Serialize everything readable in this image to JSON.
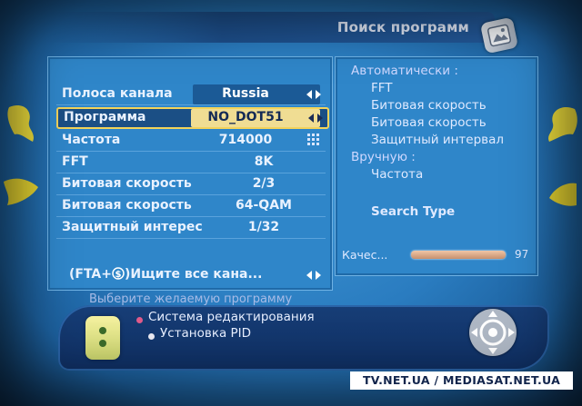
{
  "title": "Поиск программ",
  "rows": [
    {
      "label": "Полоса канала",
      "value": "Russia",
      "has_arrows": true
    },
    {
      "label": "Программа",
      "value": "NO_DOT51",
      "has_arrows": true,
      "selected": true
    },
    {
      "label": "Частота",
      "value": "714000",
      "has_keypad": true
    },
    {
      "label": "FFT",
      "value": "8K"
    },
    {
      "label": "Битовая скорость",
      "value": "2/3"
    },
    {
      "label": "Битовая скорость",
      "value": "64-QAM"
    },
    {
      "label": "Защитный интерес",
      "value": "1/32"
    }
  ],
  "search_all": {
    "prefix": "(FTA+",
    "suffix": ")Ищите все кана...",
    "has_arrows": true
  },
  "right_panel": {
    "auto_header": "Автоматически :",
    "auto_items": [
      "FFT",
      "Битовая скорость",
      "Битовая скорость",
      "Защитный интервал"
    ],
    "manual_header": "Вручную :",
    "manual_items": [
      "Частота"
    ],
    "search_type": "Search Type",
    "quality_label": "Качес...",
    "quality_value": "97",
    "quality_fraction": 0.97
  },
  "hint": "Выберите желаемую программу",
  "options": [
    {
      "label": "Система редактирования",
      "bullet_color": "#e05a8a"
    },
    {
      "label": "Установка PID",
      "bullet_color": "#e9e9f2"
    }
  ],
  "watermark": "TV.NET.UA / MEDIASAT.NET.UA",
  "icons": [
    "photo-icon",
    "left-right-arrows-icon",
    "keypad-icon",
    "dollar-coin-icon",
    "info-icon",
    "remote-dpad-icon"
  ],
  "colors": {
    "panel": "#2f86c9",
    "highlight_border": "#f3d35a",
    "highlight_fill": "#f0dd93",
    "title_bar": "#23599a"
  }
}
